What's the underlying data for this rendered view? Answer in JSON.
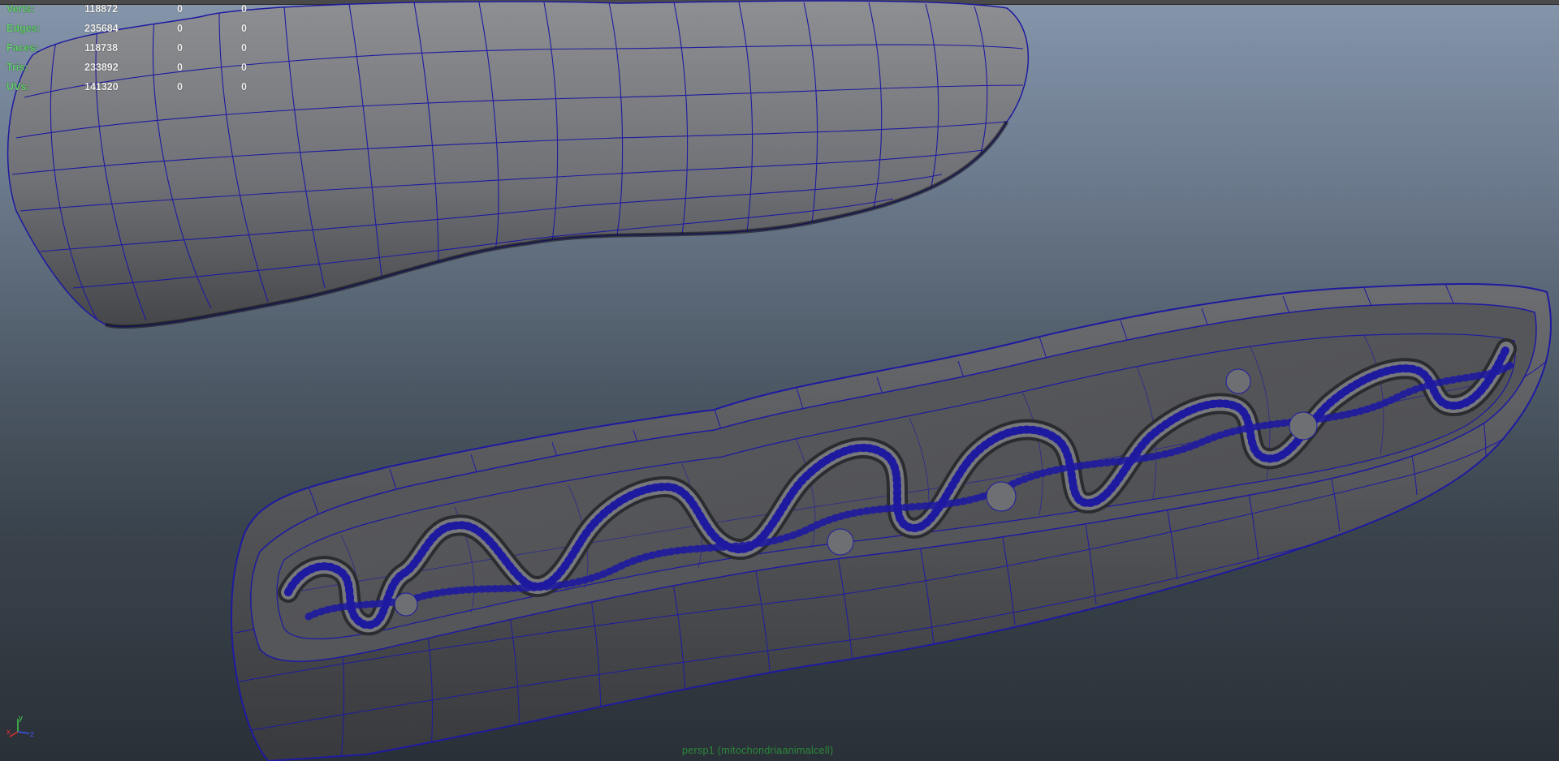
{
  "hud": {
    "rows": [
      {
        "label": "Verts:",
        "total": "118872",
        "selected": "0",
        "components": "0"
      },
      {
        "label": "Edges:",
        "total": "235684",
        "selected": "0",
        "components": "0"
      },
      {
        "label": "Faces:",
        "total": "118738",
        "selected": "0",
        "components": "0"
      },
      {
        "label": "Tris:",
        "total": "233892",
        "selected": "0",
        "components": "0"
      },
      {
        "label": "UVs:",
        "total": "141320",
        "selected": "0",
        "components": "0"
      }
    ]
  },
  "axis": {
    "x": "x",
    "y": "y",
    "z": "z"
  },
  "camera_label": "persp1 (mitochondriaanimalcell)",
  "colors": {
    "hud_label": "#64d26e",
    "wire": "#1e1aa0",
    "mesh_dark": "#3c3d41",
    "mesh_light": "#8c8d91"
  }
}
